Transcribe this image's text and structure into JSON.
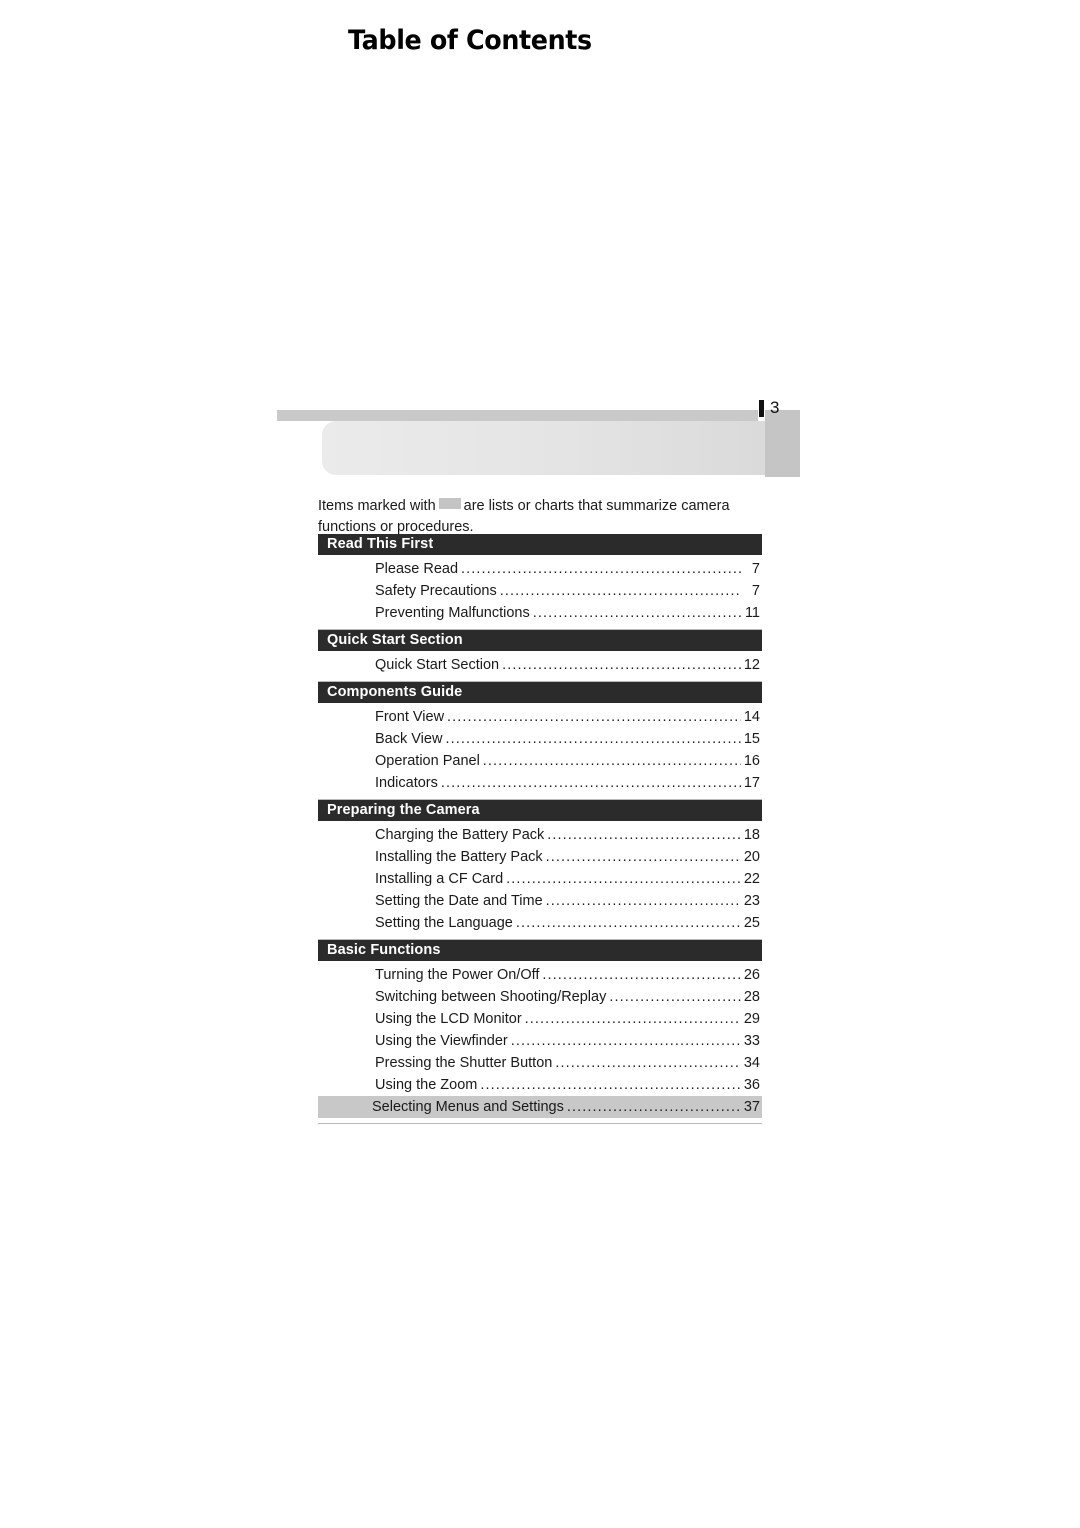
{
  "page": {
    "folio": "3",
    "title": "Table of Contents"
  },
  "intro": {
    "before_swatch": "Items marked with",
    "after_swatch": "are lists or charts that summarize camera functions or procedures."
  },
  "toc": {
    "sections": [
      {
        "heading": "Read This First",
        "entries": [
          {
            "title": "Please Read",
            "page": "7",
            "highlight": false
          },
          {
            "title": "Safety Precautions",
            "page": "7",
            "highlight": false
          },
          {
            "title": "Preventing Malfunctions",
            "page": "11",
            "highlight": false
          }
        ]
      },
      {
        "heading": "Quick Start Section",
        "entries": [
          {
            "title": "Quick Start Section",
            "page": "12",
            "highlight": false
          }
        ]
      },
      {
        "heading": "Components Guide",
        "entries": [
          {
            "title": "Front View",
            "page": "14",
            "highlight": false
          },
          {
            "title": "Back View",
            "page": "15",
            "highlight": false
          },
          {
            "title": "Operation Panel",
            "page": "16",
            "highlight": false
          },
          {
            "title": "Indicators",
            "page": "17",
            "highlight": false
          }
        ]
      },
      {
        "heading": "Preparing the Camera",
        "entries": [
          {
            "title": "Charging the Battery Pack",
            "page": "18",
            "highlight": false
          },
          {
            "title": "Installing the Battery Pack",
            "page": "20",
            "highlight": false
          },
          {
            "title": "Installing a CF Card",
            "page": "22",
            "highlight": false
          },
          {
            "title": "Setting the Date and Time",
            "page": "23",
            "highlight": false
          },
          {
            "title": "Setting the Language",
            "page": "25",
            "highlight": false
          }
        ]
      },
      {
        "heading": "Basic Functions",
        "entries": [
          {
            "title": "Turning the Power On/Off",
            "page": "26",
            "highlight": false
          },
          {
            "title": "Switching between Shooting/Replay",
            "page": "28",
            "highlight": false
          },
          {
            "title": "Using the LCD Monitor",
            "page": "29",
            "highlight": false
          },
          {
            "title": "Using the Viewfinder",
            "page": "33",
            "highlight": false
          },
          {
            "title": "Pressing the Shutter Button",
            "page": "34",
            "highlight": false
          },
          {
            "title": "Using the Zoom",
            "page": "36",
            "highlight": false
          },
          {
            "title": "Selecting Menus and Settings",
            "page": "37",
            "highlight": true
          }
        ]
      }
    ]
  },
  "colors": {
    "section_header_bg": "#2b2b2b",
    "highlight_bg": "#c8c8c8",
    "rule_gray": "#c9c9c9",
    "tab_gray": "#c5c5c5"
  }
}
